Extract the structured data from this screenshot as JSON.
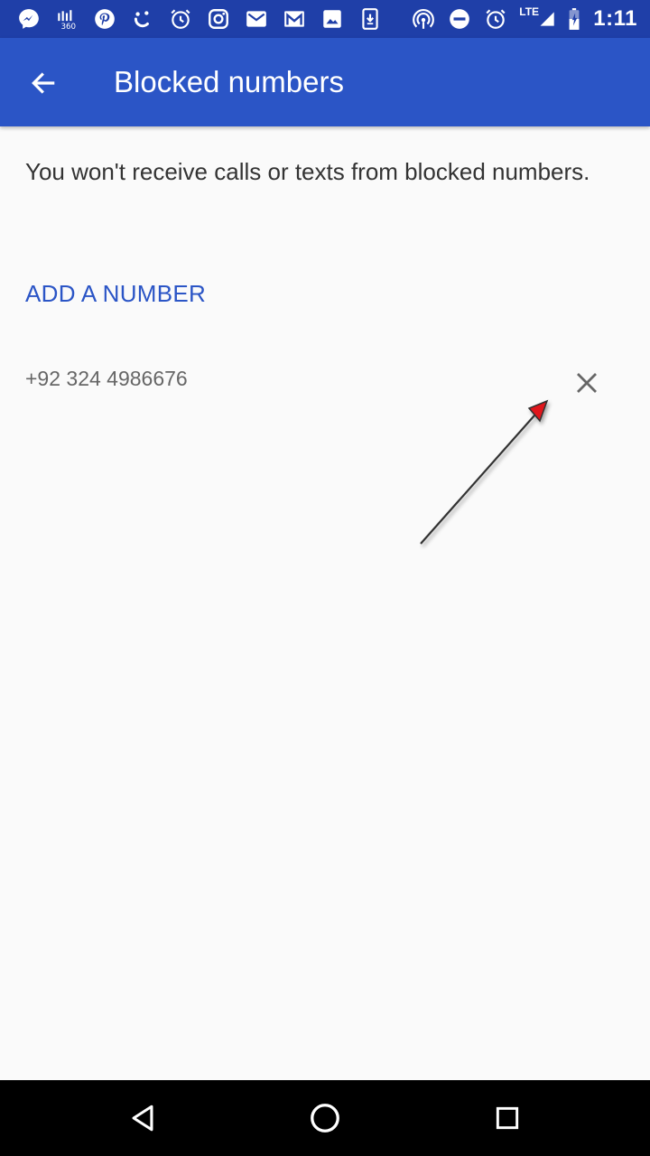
{
  "status_bar": {
    "time": "1:11",
    "network": "LTE",
    "left_icons": [
      "messenger-icon",
      "zong-360-icon",
      "pinterest-icon",
      "refresh-icon",
      "alarm-icon",
      "instagram-icon",
      "gmail-icon",
      "gmail-alt-icon",
      "photo-icon",
      "download-icon"
    ],
    "right_icons": [
      "hotspot-icon",
      "do-not-disturb-icon",
      "alarm-icon",
      "signal-icon",
      "battery-charging-icon"
    ],
    "badge_text": "360"
  },
  "app_bar": {
    "title": "Blocked numbers",
    "background": "#2b55c6"
  },
  "content": {
    "description": "You won't receive calls or texts from blocked numbers.",
    "add_label": "ADD A NUMBER",
    "blocked": [
      {
        "number": "+92 324 4986676"
      }
    ]
  },
  "colors": {
    "accent": "#2b55c6",
    "status_bar": "#1f3fa8",
    "annotation_arrow_head": "#d01010"
  }
}
